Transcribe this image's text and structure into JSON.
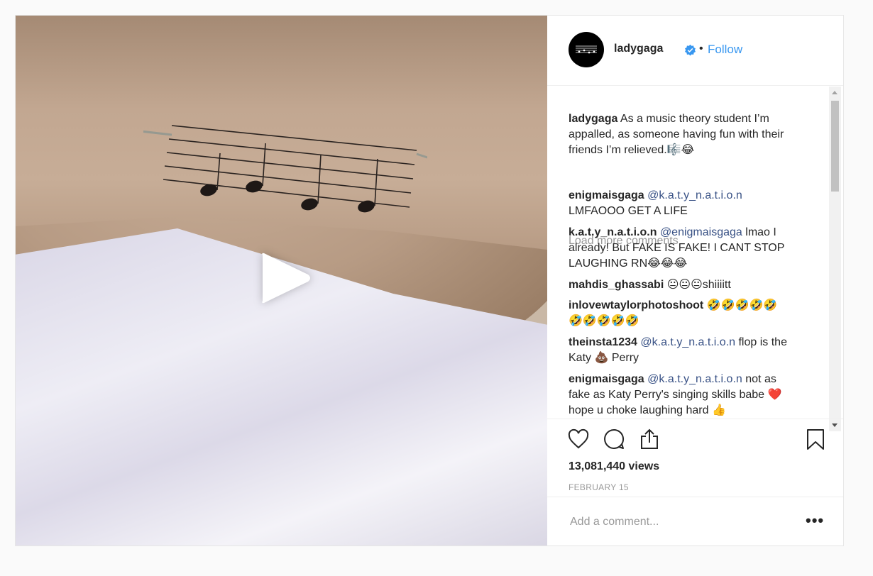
{
  "header": {
    "username": "ladygaga",
    "separator": "•",
    "follow_label": "Follow"
  },
  "caption": {
    "username": "ladygaga",
    "text": "As a music theory student I’m appalled, as someone having fun with their friends I’m relieved.🎼😂"
  },
  "load_more_label": "Load more comments",
  "comments": [
    {
      "username": "enigmaisgaga",
      "mention": "@k.a.t.y_n.a.t.i.o.n",
      "text": "LMFAOOO GET A LIFE"
    },
    {
      "username": "k.a.t.y_n.a.t.i.o.n",
      "mention": "@enigmaisgaga",
      "text": "lmao I already! But FAKE IS FAKE! I CANT STOP LAUGHING RN😂😂😂"
    },
    {
      "username": "mahdis_ghassabi",
      "mention": "",
      "text": "😐😐😐shiiiitt"
    },
    {
      "username": "inlovewtaylorphotoshoot",
      "mention": "",
      "text": "🤣🤣🤣🤣🤣🤣🤣🤣🤣🤣"
    },
    {
      "username": "theinsta1234",
      "mention": "@k.a.t.y_n.a.t.i.o.n",
      "text": "flop is the Katy 💩 Perry"
    },
    {
      "username": "enigmaisgaga",
      "mention": "@k.a.t.y_n.a.t.i.o.n",
      "text": "not as fake as Katy Perry's singing skills babe ❤️ hope u choke laughing hard 👍"
    }
  ],
  "stats": {
    "views": "13,081,440 views",
    "date": "FEBRUARY 15"
  },
  "add_comment": {
    "placeholder": "Add a comment...",
    "more_label": "•••"
  },
  "icons": {
    "play": "play-icon",
    "verified": "verified-badge-icon",
    "like": "heart-icon",
    "comment": "comment-bubble-icon",
    "share": "share-icon",
    "save": "bookmark-icon"
  },
  "colors": {
    "accent": "#3897f0",
    "text": "#262626",
    "muted": "#999999"
  }
}
